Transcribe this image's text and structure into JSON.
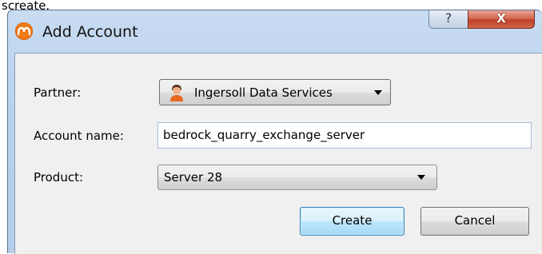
{
  "page_caption": "screate.",
  "dialog": {
    "title": "Add Account",
    "help_label": "?",
    "close_label": "X"
  },
  "form": {
    "partner_label": "Partner:",
    "partner_value": "Ingersoll Data Services",
    "account_name_label": "Account name:",
    "account_name_value": "bedrock_quarry_exchange_server",
    "product_label": "Product:",
    "product_value": "Server 28"
  },
  "buttons": {
    "create_label": "Create",
    "cancel_label": "Cancel"
  },
  "icons": {
    "app": "app-logo-icon",
    "partner": "person-icon",
    "dropdown": "chevron-down-icon"
  },
  "colors": {
    "app_icon": "#f07a16",
    "close_button": "#c0412a",
    "create_button_border": "#3c7fb1"
  }
}
